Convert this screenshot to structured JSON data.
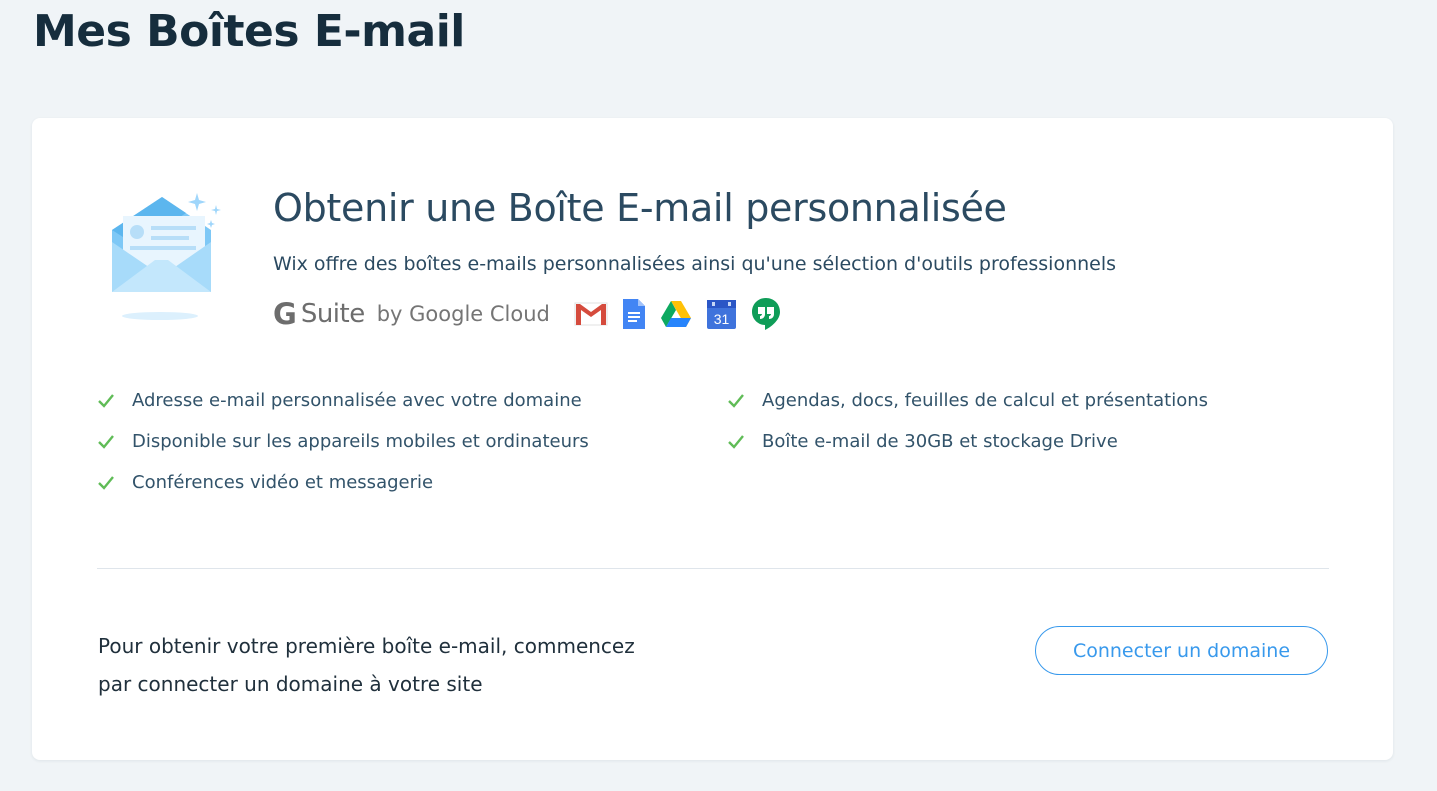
{
  "page": {
    "title": "Mes Boîtes E-mail"
  },
  "promo": {
    "title": "Obtenir une Boîte E-mail personnalisée",
    "subtitle": "Wix offre des boîtes e-mails personnalisées ainsi qu'une sélection d'outils professionnels",
    "illustration_icon": "mail-envelope-icon",
    "gsuite": {
      "g": "G",
      "suite": "Suite",
      "by": "by Google Cloud",
      "apps": [
        "gmail-icon",
        "google-docs-icon",
        "google-drive-icon",
        "google-calendar-icon",
        "google-hangouts-icon"
      ],
      "calendar_day": "31"
    },
    "features_left": [
      "Adresse e-mail personnalisée avec votre domaine",
      "Disponible sur les appareils mobiles et ordinateurs",
      "Conférences vidéo et messagerie"
    ],
    "features_right": [
      "Agendas, docs, feuilles de calcul et présentations",
      "Boîte e-mail de 30GB et stockage Drive"
    ]
  },
  "cta": {
    "text_line1": "Pour obtenir votre première boîte e-mail, commencez",
    "text_line2": "par connecter un domaine à votre site",
    "button_label": "Connecter un domaine"
  },
  "colors": {
    "background": "#f0f4f7",
    "accent": "#3899ec",
    "check": "#60bc57",
    "title": "#162d3d"
  }
}
